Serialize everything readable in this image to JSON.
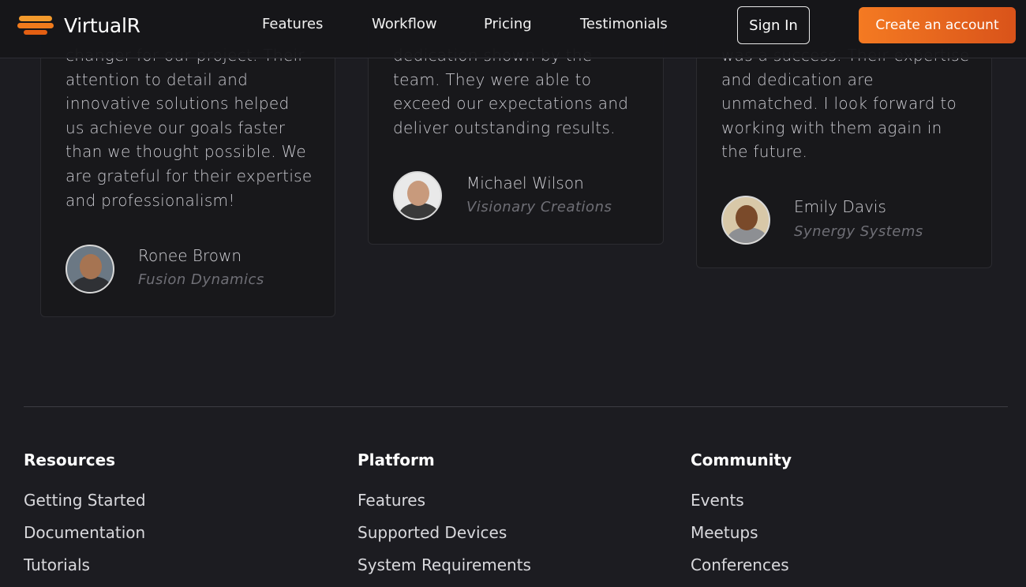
{
  "header": {
    "brand": "VirtualR",
    "nav": [
      "Features",
      "Workflow",
      "Pricing",
      "Testimonials"
    ],
    "sign_in": "Sign In",
    "create_account": "Create an account"
  },
  "testimonials": [
    {
      "quote_lines": [
        "changer for our project. Their",
        "attention to detail and",
        "innovative solutions helped",
        "us achieve our goals faster",
        "than we thought possible. We",
        "are grateful for their expertise",
        "and professionalism!"
      ],
      "name": "Ronee Brown",
      "company": "Fusion Dynamics"
    },
    {
      "quote_lines": [
        "dedication shown by the",
        "team. They were able to",
        "exceed our expectations and",
        "deliver outstanding results."
      ],
      "name": "Michael Wilson",
      "company": "Visionary Creations"
    },
    {
      "quote_lines": [
        "was a success. Their expertise",
        "and dedication are",
        "unmatched. I look forward to",
        "working with them again in",
        "the future."
      ],
      "name": "Emily Davis",
      "company": "Synergy Systems"
    }
  ],
  "footer": {
    "resources": {
      "title": "Resources",
      "links": [
        "Getting Started",
        "Documentation",
        "Tutorials"
      ]
    },
    "platform": {
      "title": "Platform",
      "links": [
        "Features",
        "Supported Devices",
        "System Requirements"
      ]
    },
    "community": {
      "title": "Community",
      "links": [
        "Events",
        "Meetups",
        "Conferences"
      ]
    }
  }
}
